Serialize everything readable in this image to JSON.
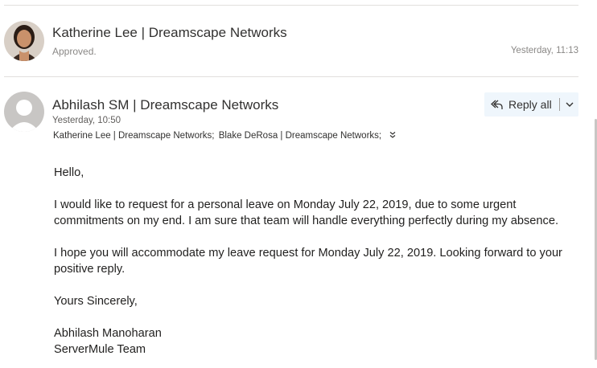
{
  "thread": [
    {
      "sender": "Katherine Lee | Dreamscape Networks",
      "preview": "Approved.",
      "time": "Yesterday, 11:13",
      "avatar": "photo-avatar"
    },
    {
      "sender": "Abhilash SM | Dreamscape Networks",
      "time": "Yesterday, 10:50",
      "recipients": [
        "Katherine Lee | Dreamscape Networks;",
        "Blake DeRosa | Dreamscape Networks;"
      ],
      "avatar": "person-placeholder-icon",
      "reply_all_label": "Reply all",
      "body": {
        "greeting": "Hello,",
        "paragraph1": "I would like to request for a personal leave on Monday July 22, 2019, due to some urgent commitments on my end. I am sure that team will handle everything perfectly during my absence.",
        "paragraph2": "I hope you will accommodate my leave request for Monday July 22, 2019. Looking forward to your positive reply.",
        "closing": "Yours Sincerely,",
        "signature_name": "Abhilash Manoharan",
        "signature_team": "ServerMule Team"
      }
    }
  ],
  "icons": {
    "reply_all": "reply-all-icon",
    "dropdown": "chevron-down-icon",
    "expand_recipients": "double-chevron-down-icon"
  },
  "colors": {
    "reply_button_bg": "#eff6fc",
    "divider": "#e1dfdd",
    "muted_text": "#8a8886"
  }
}
